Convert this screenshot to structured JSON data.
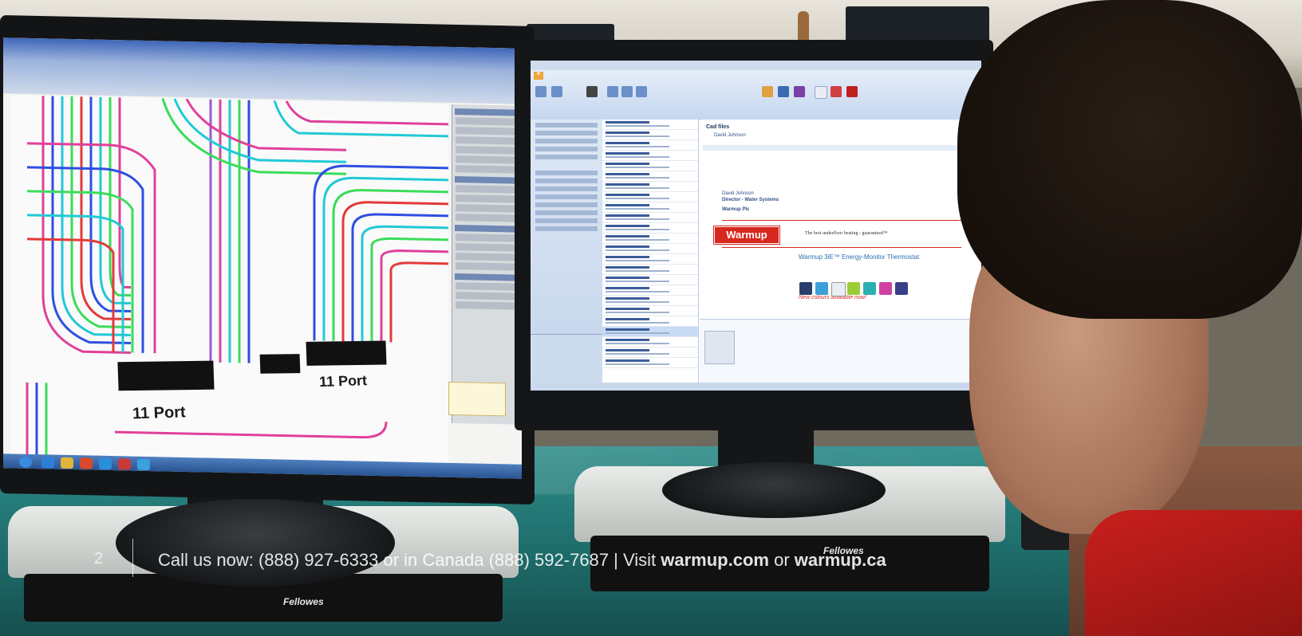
{
  "photo": {
    "description_tags": [
      "office-desk",
      "dual-monitors",
      "person"
    ]
  },
  "left_monitor": {
    "cad_labels": [
      "11 Port",
      "11 Port"
    ],
    "colors": {
      "pipe_colors": [
        "#e0409a",
        "#2e4fe0",
        "#21c9d6",
        "#3bdc5a",
        "#e33a3a",
        "#9b59d0"
      ]
    }
  },
  "right_monitor": {
    "email_subject": "Cad files",
    "sender": "David Johnson",
    "brand": "Warmup",
    "tagline": "The best underfloor heating - guaranteed™",
    "product_line": "Warmup 3iE™ Energy-Monitor Thermostat",
    "promo": "New colours available now!",
    "signature_name": "David Johnson",
    "signature_title": "Director - Water Systems",
    "signature_company": "Warmup Plc"
  },
  "risers": {
    "brand": "Fellowes"
  },
  "footer": {
    "page_number": "2",
    "call_prefix": "Call us now: (888) 927-6333 or in Canada (888) 592-7687 | Visit",
    "site1": "warmup.com",
    "or_word": "or",
    "site2": "warmup.ca"
  }
}
